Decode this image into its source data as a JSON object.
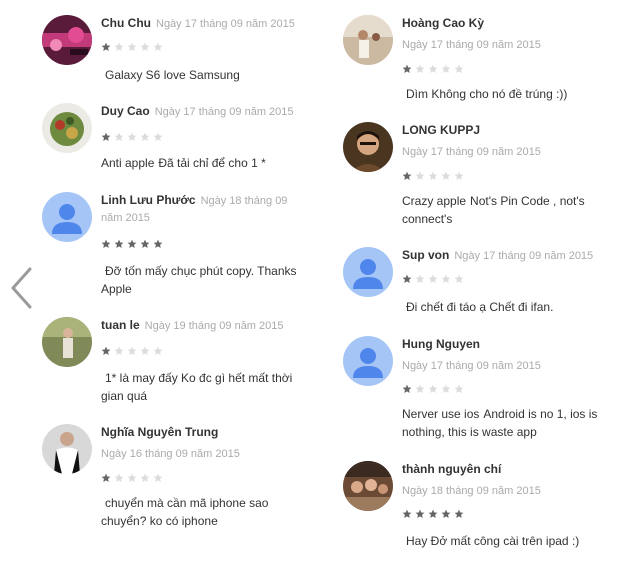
{
  "nav": {
    "icon": "chevron-left-icon"
  },
  "left_reviews": [
    {
      "author": "Chu Chu",
      "date": "Ngày 17 tháng 09 năm 2015",
      "rating": 1,
      "title": "",
      "body": "Galaxy S6 love Samsung",
      "avatar": "photo"
    },
    {
      "author": "Duy Cao",
      "date": "Ngày 17 tháng 09 năm 2015",
      "rating": 1,
      "title": "Anti apple",
      "body": "Đã tải chỉ để cho 1 *",
      "avatar": "photo"
    },
    {
      "author": "Linh Lưu Phước",
      "date": "Ngày 18 tháng 09 năm 2015",
      "rating": 5,
      "title": "",
      "body": "Đỡ tốn mấy chục phút copy. Thanks Apple",
      "avatar": "default"
    },
    {
      "author": "tuan le",
      "date": "Ngày 19 tháng 09 năm 2015",
      "rating": 1,
      "title": "",
      "body": "1* là may đấy Ko đc gì hết mất thời gian quá",
      "avatar": "photo"
    },
    {
      "author": "Nghĩa Nguyên Trung",
      "date": "Ngày 16 tháng 09 năm 2015",
      "rating": 1,
      "title": "",
      "body": "chuyển mà cần mã iphone sao chuyển? ko có iphone",
      "avatar": "photo"
    }
  ],
  "right_reviews": [
    {
      "author": "Hoàng Cao Kỳ",
      "date": "Ngày 17 tháng 09 năm 2015",
      "rating": 1,
      "title": "",
      "body": "Dìm Không cho nó đề trúng :))",
      "avatar": "photo"
    },
    {
      "author": "LONG KUPPJ",
      "date": "Ngày 17 tháng 09 năm 2015",
      "rating": 1,
      "title": "Crazy apple",
      "body": "Not's Pin Code , not's connect's",
      "avatar": "photo"
    },
    {
      "author": "Sup von",
      "date": "Ngày 17 tháng 09 năm 2015",
      "rating": 1,
      "title": "",
      "body": "Đi chết đi táo ạ Chết đi ifan.",
      "avatar": "default"
    },
    {
      "author": "Hung Nguyen",
      "date": "Ngày 17 tháng 09 năm 2015",
      "rating": 1,
      "title": "Nerver use ios",
      "body": "Android is no 1, ios is nothing, this is waste app",
      "avatar": "default"
    },
    {
      "author": "thành nguyên chí",
      "date": "Ngày 18 tháng 09 năm 2015",
      "rating": 5,
      "title": "",
      "body": "Hay Đở mất công cài trên ipad :)",
      "avatar": "photo"
    }
  ],
  "colors": {
    "star_filled": "#666666",
    "star_empty": "#dcdcdc",
    "default_avatar_bg": "#a6c5f7",
    "default_avatar_fg": "#4f86ec",
    "nav_arrow": "#9a9a9a"
  }
}
